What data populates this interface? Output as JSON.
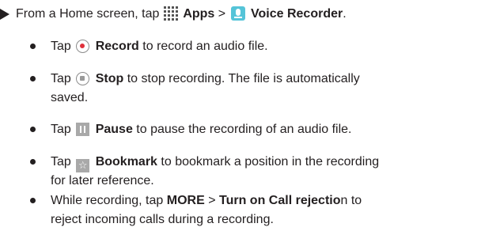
{
  "intro": {
    "pre": "From a Home screen, tap",
    "apps": "Apps",
    "separator": ">",
    "voice_recorder": "Voice Recorder",
    "period": "."
  },
  "bullets": [
    {
      "tap": "Tap",
      "label": "Record",
      "rest": "to record an audio file."
    },
    {
      "tap": "Tap",
      "label": "Stop",
      "rest": "to stop recording. The file is automatically",
      "rest2": "saved."
    },
    {
      "tap": "Tap",
      "label": "Pause",
      "rest": "to pause the recording of an audio file."
    },
    {
      "tap": "Tap",
      "label": "Bookmark",
      "rest": "to bookmark a position in the recording",
      "rest2": "for later reference."
    }
  ],
  "last_bullet": {
    "pre": "While recording, tap",
    "more": "MORE",
    "separator": ">",
    "turn_on": "Turn on Call rejectio",
    "n": "n",
    "rest": "to",
    "line2": "reject incoming calls during a recording."
  },
  "icons": {
    "apps": "apps-grid-icon",
    "voice_recorder": "voice-recorder-icon",
    "record": "record-icon",
    "stop": "stop-icon",
    "pause": "pause-icon",
    "bookmark": "bookmark-icon"
  }
}
